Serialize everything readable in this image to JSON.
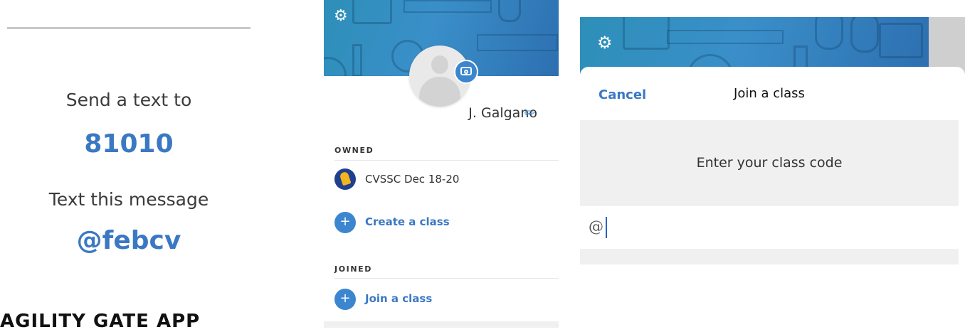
{
  "text_panel": {
    "send_label": "Send a text to",
    "number": "81010",
    "message_label": "Text this message",
    "keyword": "@febcv",
    "bottom_heading": "AGILITY GATE APP"
  },
  "profile_panel": {
    "name": "J. Galgano",
    "owned_label": "OWNED",
    "owned_classes": [
      {
        "name": "CVSSC Dec 18-20"
      }
    ],
    "create_label": "Create a class",
    "joined_label": "JOINED",
    "join_label": "Join a class",
    "icons": {
      "settings": "gear-icon",
      "camera": "camera-icon",
      "edit": "pencil-icon",
      "plus": "+"
    }
  },
  "join_panel": {
    "cancel_label": "Cancel",
    "title": "Join a class",
    "code_prompt": "Enter your class code",
    "code_input_value": "@"
  },
  "colors": {
    "accent_blue": "#3b78c3",
    "button_blue": "#3b86cf",
    "banner_teal": "#2d8fb8",
    "light_grey": "#f0f0f0"
  }
}
